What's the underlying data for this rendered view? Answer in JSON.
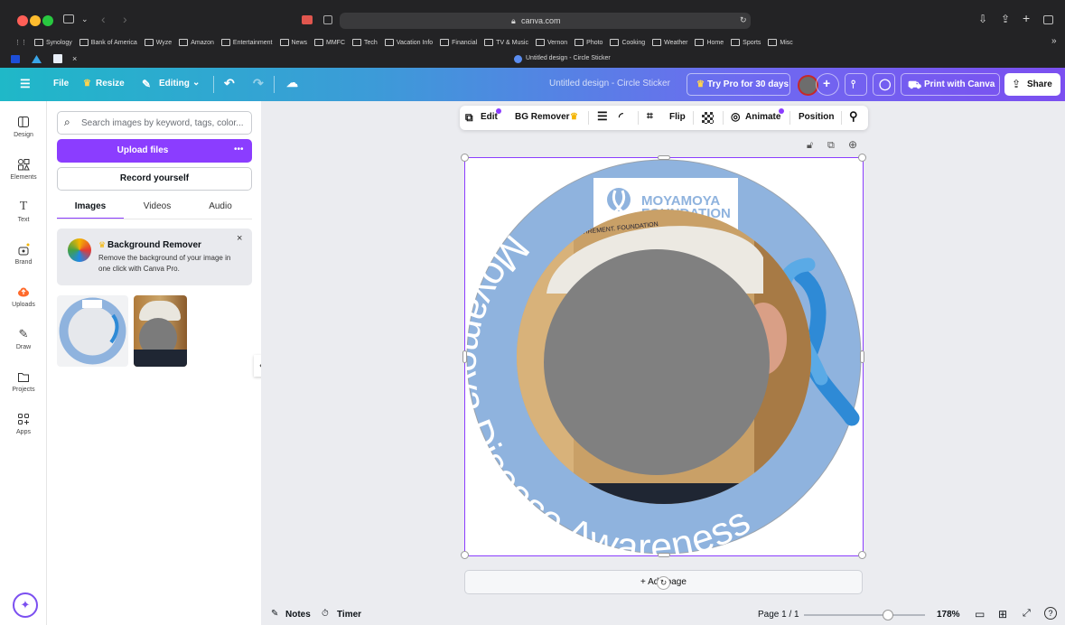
{
  "browser": {
    "url": "canva.com",
    "tab_title": "Untitled design - Circle Sticker",
    "bookmarks": [
      {
        "label": "Synology"
      },
      {
        "label": "Bank of America"
      },
      {
        "label": "Wyze"
      },
      {
        "label": "Amazon"
      },
      {
        "label": "Entertainment"
      },
      {
        "label": "News"
      },
      {
        "label": "MMFC"
      },
      {
        "label": "Tech"
      },
      {
        "label": "Vacation Info"
      },
      {
        "label": "Financial"
      },
      {
        "label": "TV & Music"
      },
      {
        "label": "Vernon"
      },
      {
        "label": "Photo"
      },
      {
        "label": "Cooking"
      },
      {
        "label": "Weather"
      },
      {
        "label": "Home"
      },
      {
        "label": "Sports"
      },
      {
        "label": "Misc"
      }
    ]
  },
  "header": {
    "file": "File",
    "resize": "Resize",
    "editing": "Editing",
    "doc_title": "Untitled design - Circle Sticker",
    "try_pro": "Try Pro for 30 days",
    "print": "Print with Canva",
    "share": "Share"
  },
  "rail": [
    {
      "label": "Design"
    },
    {
      "label": "Elements"
    },
    {
      "label": "Text"
    },
    {
      "label": "Brand"
    },
    {
      "label": "Uploads"
    },
    {
      "label": "Draw"
    },
    {
      "label": "Projects"
    },
    {
      "label": "Apps"
    }
  ],
  "panel": {
    "search_placeholder": "Search images by keyword, tags, color...",
    "upload": "Upload files",
    "more": "•••",
    "record": "Record yourself",
    "tabs": [
      {
        "label": "Images"
      },
      {
        "label": "Videos"
      },
      {
        "label": "Audio"
      }
    ],
    "promo_title": "Background Remover",
    "promo_text": "Remove the background of your image in one click with Canva Pro."
  },
  "toolbar": {
    "edit": "Edit",
    "bg_remover": "BG Remover",
    "flip": "Flip",
    "animate": "Animate",
    "position": "Position"
  },
  "design": {
    "ring_text": "Moyamoya Disease Awareness",
    "logo_top": "MOYAMOYA",
    "logo_bottom": "FOUNDATION",
    "hat_text": "RETIREMENT. FOUNDATION"
  },
  "add_page": "+ Add page",
  "footer": {
    "notes": "Notes",
    "timer": "Timer",
    "page": "Page 1 / 1",
    "zoom": "178%"
  },
  "colors": {
    "accent": "#8b3dff",
    "ring": "#8fb3de",
    "header_start": "#1fb8c8",
    "header_end": "#7b4ff0"
  }
}
